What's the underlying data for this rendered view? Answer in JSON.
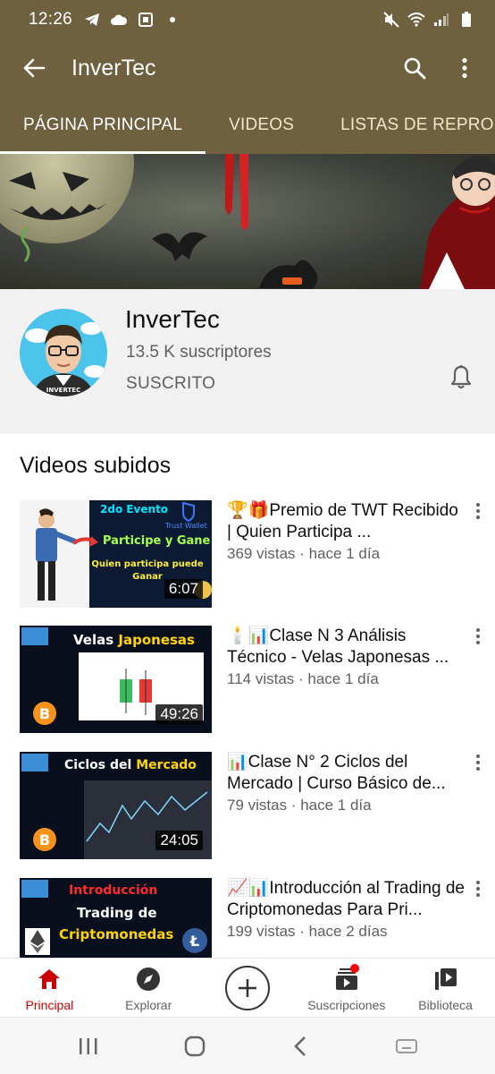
{
  "status_bar": {
    "time": "12:26"
  },
  "app_bar": {
    "title": "InverTec"
  },
  "tabs": [
    {
      "label": "PÁGINA PRINCIPAL",
      "active": true
    },
    {
      "label": "VIDEOS",
      "active": false
    },
    {
      "label": "LISTAS DE REPRO",
      "active": false
    }
  ],
  "channel": {
    "name": "InverTec",
    "subscribers": "13.5 K suscriptores",
    "subscribe_state": "SUSCRITO",
    "avatar_caption": "INVERTEC"
  },
  "section": {
    "title": "Videos subidos"
  },
  "videos": [
    {
      "title": "🏆🎁Premio de TWT Recibido | Quien Participa ...",
      "meta": "369 vistas · hace 1 día",
      "duration": "6:07",
      "thumb_lines": [
        "2do Evento",
        "Trust Wallet",
        "Participe y Gane",
        "Quien participa puede",
        "Ganar"
      ]
    },
    {
      "title": "🕯️📊Clase N 3 Análisis Técnico - Velas Japonesas ...",
      "meta": "114 vistas · hace 1 día",
      "duration": "49:26",
      "thumb_lines": [
        "Velas",
        "Japonesas"
      ]
    },
    {
      "title": "📊Clase N° 2 Ciclos del Mercado | Curso Básico de...",
      "meta": "79 vistas · hace 1 día",
      "duration": "24:05",
      "thumb_lines": [
        "Ciclos del",
        "Mercado"
      ]
    },
    {
      "title": "📈📊Introducción al Trading de Criptomonedas Para Pri...",
      "meta": "199 vistas · hace 2 días",
      "duration": "",
      "thumb_lines": [
        "Introducción",
        "Trading de",
        "Criptomonedas"
      ]
    }
  ],
  "bottom_nav": [
    {
      "label": "Principal",
      "icon": "home-icon",
      "active": true
    },
    {
      "label": "Explorar",
      "icon": "compass-icon",
      "active": false
    },
    {
      "label": "",
      "icon": "create-icon",
      "active": false
    },
    {
      "label": "Suscripciones",
      "icon": "subscriptions-icon",
      "active": false
    },
    {
      "label": "Biblioteca",
      "icon": "library-icon",
      "active": false
    }
  ],
  "colors": {
    "app_bar": "#6f613f",
    "active_nav": "#cc0000",
    "text_secondary": "#606060"
  }
}
